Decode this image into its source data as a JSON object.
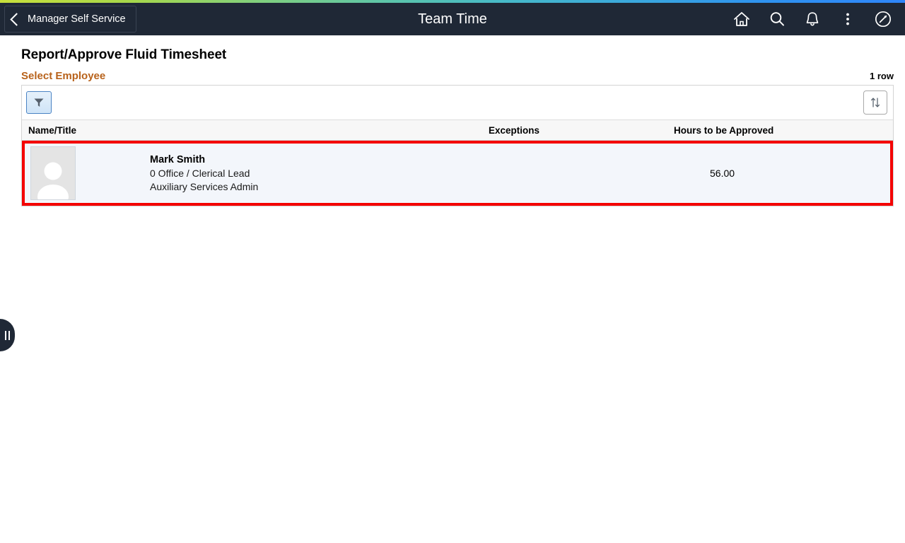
{
  "header": {
    "back_label": "Manager Self Service",
    "title": "Team Time",
    "icons": [
      {
        "name": "home-icon",
        "label": "Home"
      },
      {
        "name": "search-icon",
        "label": "Search"
      },
      {
        "name": "notifications-bell-icon",
        "label": "Notifications"
      },
      {
        "name": "actions-menu-icon",
        "label": "Actions"
      },
      {
        "name": "navbar-compass-icon",
        "label": "NavBar"
      }
    ],
    "background_color": "#1F2836",
    "gradient_start": "#C8E03C",
    "gradient_end": "#2F86FA"
  },
  "page": {
    "title": "Report/Approve Fluid Timesheet",
    "section_title": "Select Employee",
    "section_title_color": "#B8621B",
    "row_count": "1 row"
  },
  "toolbar": {
    "filter_icon": "filter-funnel-icon",
    "sort_icon": "sort-updown-icon"
  },
  "grid": {
    "columns": [
      {
        "key": "name_title",
        "label": "Name/Title"
      },
      {
        "key": "exceptions",
        "label": "Exceptions"
      },
      {
        "key": "hours",
        "label": "Hours to be Approved"
      }
    ],
    "rows": [
      {
        "avatar": "employee-photo-placeholder",
        "name": "Mark Smith",
        "title_line1": "0 Office / Clerical Lead",
        "title_line2": "Auxiliary Services Admin",
        "exceptions": "",
        "hours": "56.00",
        "selected": true,
        "selection_color": "#F40000",
        "row_background": "#F3F6FB"
      }
    ]
  },
  "side_tab": {
    "name": "collapse-panel-handle"
  }
}
